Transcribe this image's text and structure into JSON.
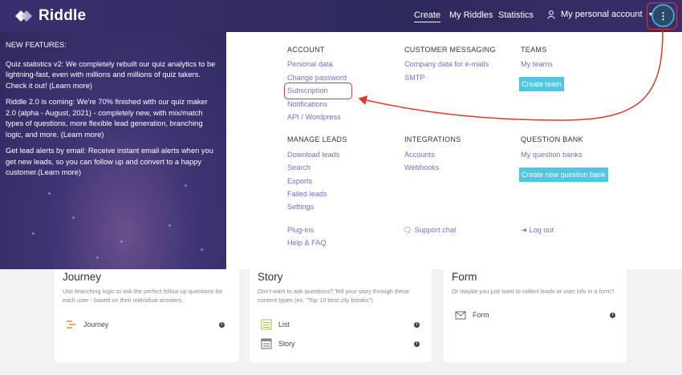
{
  "header": {
    "logo_text": "Riddle",
    "nav": [
      {
        "label": "Create",
        "active": true
      },
      {
        "label": "My Riddles",
        "active": false
      },
      {
        "label": "Statistics",
        "active": false
      }
    ],
    "account_label": "My personal account",
    "kebab_label": "⋮"
  },
  "features": {
    "title": "NEW FEATURES:",
    "items": [
      "Quiz statistics v2: We completely rebuilt our quiz analytics to be lightning-fast, even with millions and millions of quiz takers. Check it out! (Learn more)",
      "Riddle 2.0 is coming: We're 70% finished with our quiz maker 2.0 (alpha - August, 2021) - completely new, with mix/match types of questions, more flexible lead generation, branching logic, and more. (Learn more)",
      "Get lead alerts by email: Receive instant email alerts when you get new leads, so you can follow up and convert to a happy customer.(Learn more)"
    ]
  },
  "menu": {
    "account": {
      "heading": "ACCOUNT",
      "links": [
        "Personal data",
        "Change password",
        "Subscription",
        "Notifications",
        "API / Wordpress"
      ]
    },
    "customer_messaging": {
      "heading": "CUSTOMER MESSAGING",
      "links": [
        "Company data for e-mails",
        "SMTP"
      ]
    },
    "teams": {
      "heading": "TEAMS",
      "links": [
        "My teams"
      ],
      "button": "Create team"
    },
    "manage_leads": {
      "heading": "MANAGE LEADS",
      "links": [
        "Download leads",
        "Search",
        "Exports",
        "Failed leads",
        "Settings"
      ]
    },
    "integrations": {
      "heading": "INTEGRATIONS",
      "links": [
        "Accounts",
        "Webhooks"
      ]
    },
    "question_bank": {
      "heading": "QUESTION BANK",
      "links": [
        "My question banks"
      ],
      "button": "Create new question bank"
    },
    "footer": {
      "plugins": "Plug-ins",
      "help": "Help & FAQ",
      "support": "Support chat",
      "logout": "Log out"
    }
  },
  "cards": [
    {
      "title": "Journey",
      "desc": "Use branching logic to ask the perfect follow up questions for each user - based on their individual answers.",
      "items": [
        {
          "label": "Journey",
          "icon": "journey-icon"
        }
      ]
    },
    {
      "title": "Story",
      "desc": "Don't want to ask questions? Tell your story through these content types (ex. \"Top 10 best city breaks\")",
      "items": [
        {
          "label": "List",
          "icon": "list-icon"
        },
        {
          "label": "Story",
          "icon": "story-icon"
        }
      ]
    },
    {
      "title": "Form",
      "desc": "Or maybe you just want to collect leads or user info in a form?",
      "items": [
        {
          "label": "Form",
          "icon": "form-icon"
        }
      ]
    }
  ],
  "colors": {
    "link": "#7b6bd0",
    "button": "#4fc6e2",
    "annotation": "#e03a2c",
    "header": "#2e2a5c"
  }
}
